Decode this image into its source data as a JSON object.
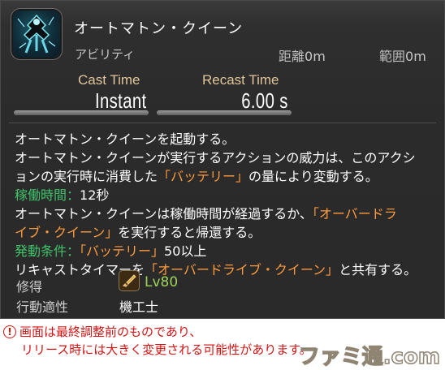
{
  "action": {
    "name": "オートマトン・クイーン",
    "category": "アビリティ",
    "range_label": "距離",
    "range_value": "0m",
    "radius_label": "範囲",
    "radius_value": "0m",
    "icon": "automaton-queen-icon"
  },
  "cast": {
    "cast_label": "Cast Time",
    "cast_value": "Instant",
    "recast_label": "Recast Time",
    "recast_value": "6.00 s"
  },
  "description": {
    "l1": "オートマトン・クイーンを起動する。",
    "l2": "オートマトン・クイーンが実行するアクションの威力は、このアクシ",
    "l3a": "ョンの実行時に消費した",
    "l3b": "「バッテリー」",
    "l3c": "の量により変動する。",
    "l4a": "稼働時間：",
    "l4b": "12秒",
    "l5a": "オートマトン・クイーンは稼働時間が経過するか、",
    "l5b": "「オーバードラ",
    "l6a": "イブ・クイーン」",
    "l6b": "を実行すると帰還する。",
    "l7a": "発動条件：",
    "l7b": "「バッテリー」",
    "l7c": "50以上",
    "l8a": "リキャストタイマーを",
    "l8b": "「オーバードライブ・クイーン」",
    "l8c": "と共有する。"
  },
  "acquired": {
    "label": "修得",
    "level": "Lv80",
    "icon": "machinist-job-icon"
  },
  "job": {
    "label": "行動適性",
    "value": "機工士"
  },
  "notice": {
    "line1": "画面は最終調整前のものであり、",
    "line2": "リリース時には大きく変更される可能性があります。"
  },
  "watermark": "ファミ通.com",
  "colors": {
    "highlight": "#ff9a3c",
    "label_green": "#3fc36a",
    "level_green": "#9ed35a",
    "header_gold": "#e0c59a",
    "notice_red": "#d31313"
  }
}
